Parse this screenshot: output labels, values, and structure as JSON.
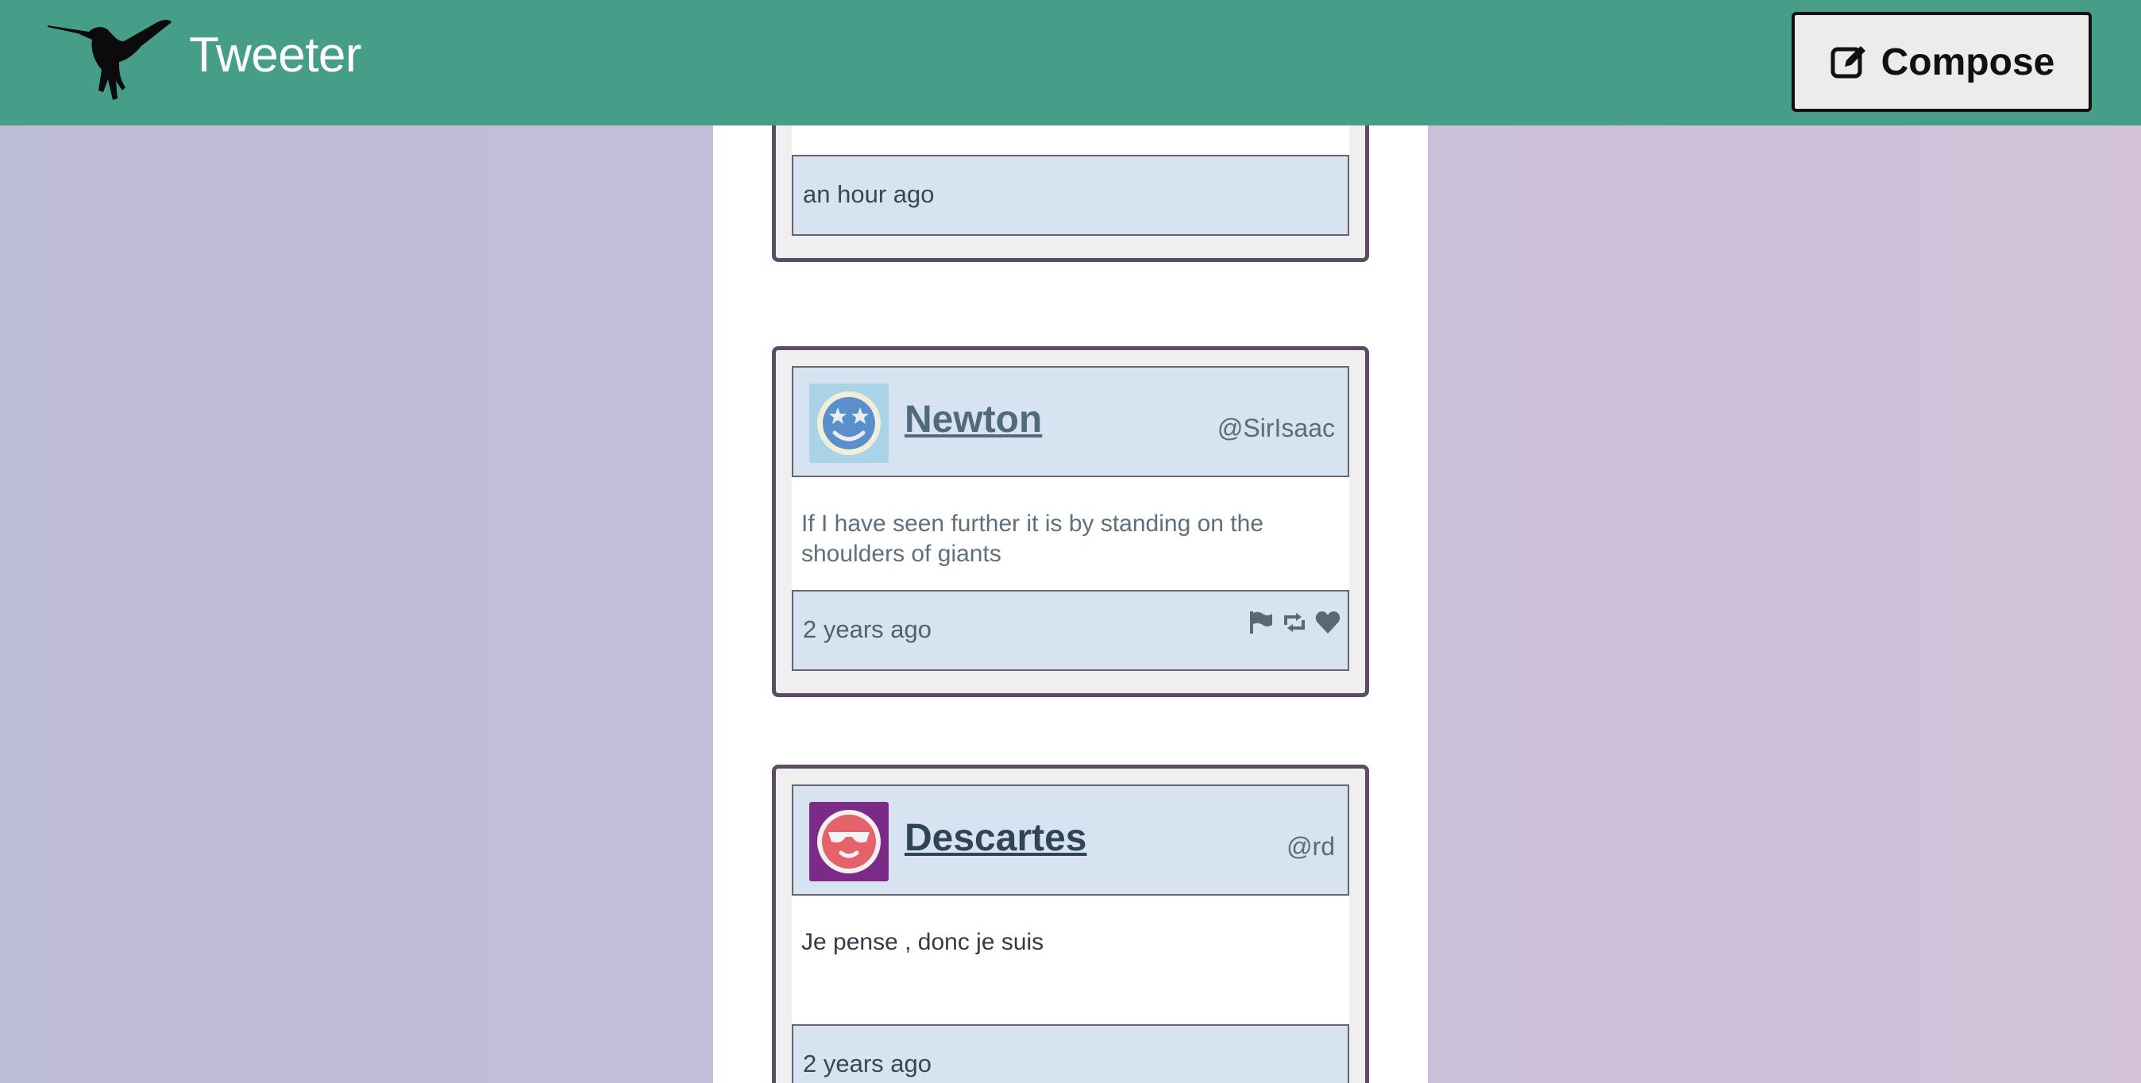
{
  "app": {
    "title": "Tweeter",
    "compose_label": "Compose"
  },
  "colors": {
    "navbar": "#469d88",
    "card_border": "#5b4e62",
    "header_bg": "#d8e3f1"
  },
  "tweets": [
    {
      "timestamp": "an hour ago"
    },
    {
      "name": "Newton",
      "handle": "@SirIsaac",
      "text": "If I have seen further it is by standing on the shoulders of giants",
      "timestamp": "2 years ago",
      "avatar_icon": "starry-eyed-smiley-avatar",
      "name_color": "#4f6b7c",
      "text_color": "#5f6f7c"
    },
    {
      "name": "Descartes",
      "handle": "@rd",
      "text": "Je pense , donc je suis",
      "timestamp": "2 years ago",
      "avatar_icon": "sunglasses-smiley-avatar",
      "name_color": "#2f4454",
      "text_color": "#333b44"
    }
  ],
  "footer_icons": [
    "flag-icon",
    "retweet-icon",
    "heart-icon"
  ]
}
